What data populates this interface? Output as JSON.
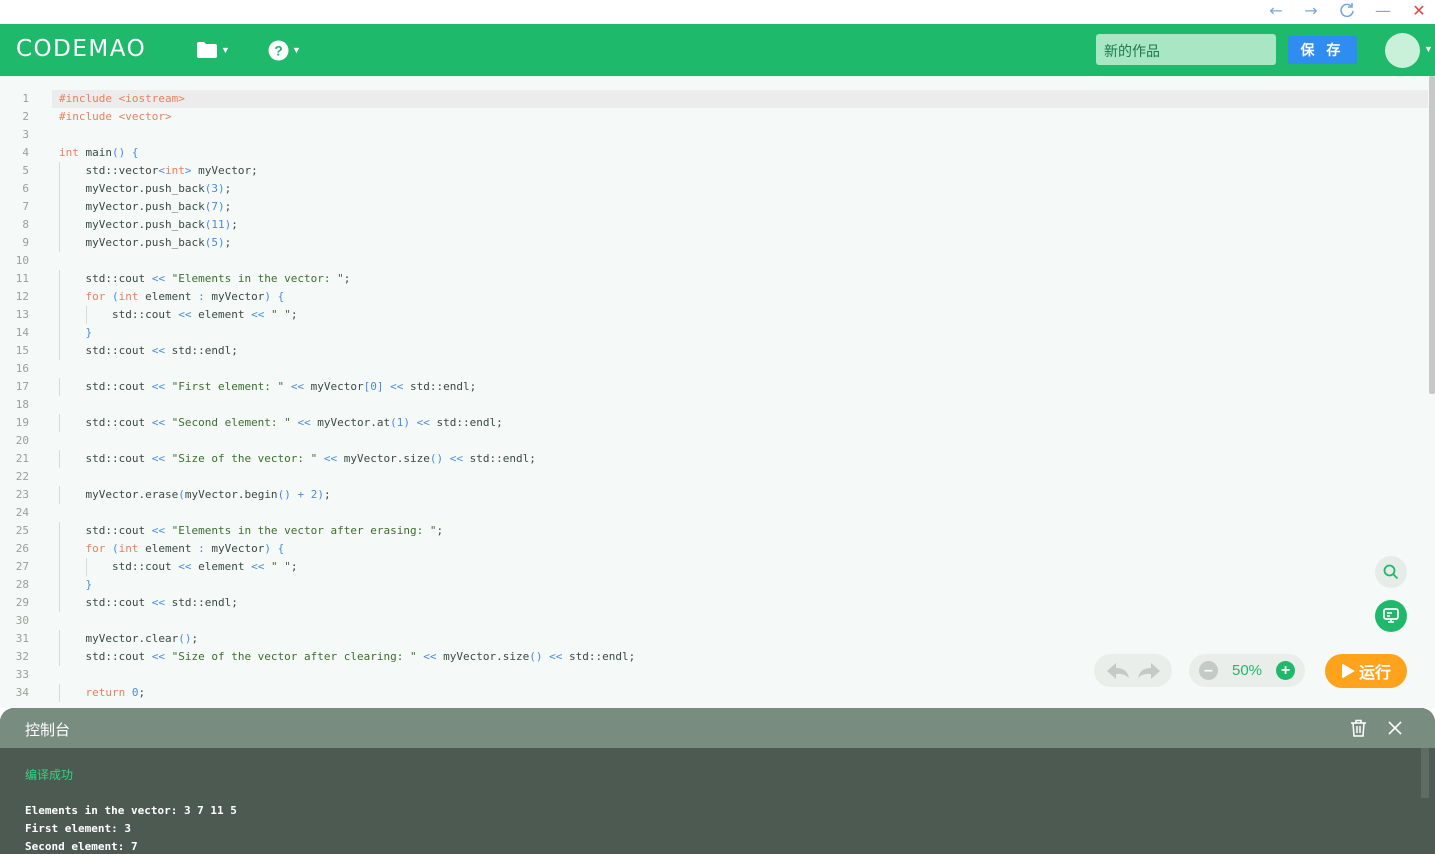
{
  "window_controls": {
    "back": "←",
    "forward": "→",
    "refresh": "C",
    "minimize": "—",
    "close": "✕"
  },
  "header": {
    "logo": "CODEMAO",
    "project_name_placeholder": "新的作品",
    "save_label": "保 存"
  },
  "editor": {
    "line_numbers": [
      "1",
      "2",
      "3",
      "4",
      "5",
      "6",
      "7",
      "8",
      "9",
      "10",
      "11",
      "12",
      "13",
      "14",
      "15",
      "16",
      "17",
      "18",
      "19",
      "20",
      "21",
      "22",
      "23",
      "24",
      "25",
      "26",
      "27",
      "28",
      "29",
      "30",
      "31",
      "32",
      "33",
      "34"
    ],
    "lines": [
      "#include <iostream>",
      "#include <vector>",
      "",
      "int main() {",
      "    std::vector<int> myVector;",
      "    myVector.push_back(3);",
      "    myVector.push_back(7);",
      "    myVector.push_back(11);",
      "    myVector.push_back(5);",
      "",
      "    std::cout << \"Elements in the vector: \";",
      "    for (int element : myVector) {",
      "        std::cout << element << \" \";",
      "    }",
      "    std::cout << std::endl;",
      "",
      "    std::cout << \"First element: \" << myVector[0] << std::endl;",
      "",
      "    std::cout << \"Second element: \" << myVector.at(1) << std::endl;",
      "",
      "    std::cout << \"Size of the vector: \" << myVector.size() << std::endl;",
      "",
      "    myVector.erase(myVector.begin() + 2);",
      "",
      "    std::cout << \"Elements in the vector after erasing: \";",
      "    for (int element : myVector) {",
      "        std::cout << element << \" \";",
      "    }",
      "    std::cout << std::endl;",
      "",
      "    myVector.clear();",
      "    std::cout << \"Size of the vector after clearing: \" << myVector.size() << std::endl;",
      "",
      "    return 0;"
    ],
    "zoom": "50%",
    "run_label": "运行"
  },
  "console": {
    "title": "控制台",
    "status": "编译成功",
    "output": [
      "Elements in the vector: 3 7 11 5",
      "First element: 3",
      "Second element: 7"
    ]
  },
  "colors": {
    "brand": "#1fb96b",
    "save": "#2f8cf0",
    "run": "#ffa21c",
    "console_bg": "#4d5a52",
    "console_header": "#788c80"
  }
}
